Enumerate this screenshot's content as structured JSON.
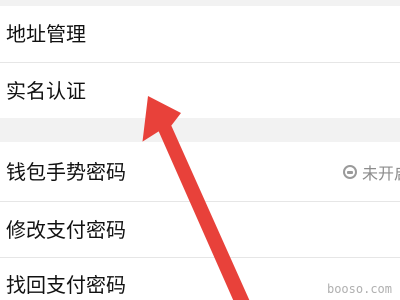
{
  "menu": {
    "items": [
      {
        "label": "地址管理"
      },
      {
        "label": "实名认证"
      },
      {
        "label": "钱包手势密码",
        "status": "未开启"
      },
      {
        "label": "修改支付密码"
      },
      {
        "label": "找回支付密码"
      }
    ]
  },
  "annotation": {
    "arrow_color": "#e8413a",
    "points_to": "实名认证"
  },
  "watermark": {
    "text": "booso.com"
  }
}
